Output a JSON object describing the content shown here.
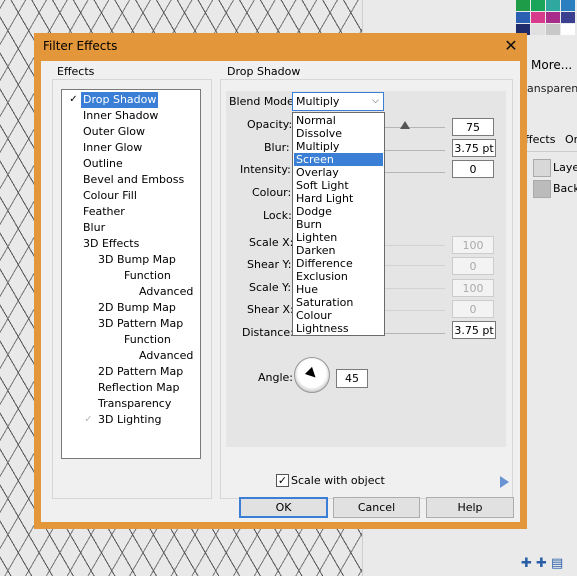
{
  "dialog": {
    "title": "Filter Effects",
    "accent_color": "#e4963a",
    "effects_group_title": "Effects",
    "right_group_title": "Drop Shadow"
  },
  "effects_tree": [
    {
      "label": "Drop Shadow",
      "level": 0,
      "checked": true,
      "selected": true,
      "has_checkbox": true
    },
    {
      "label": "Inner Shadow",
      "level": 0,
      "checked": false,
      "has_checkbox": true
    },
    {
      "label": "Outer Glow",
      "level": 0,
      "checked": false,
      "has_checkbox": true
    },
    {
      "label": "Inner Glow",
      "level": 0,
      "checked": false,
      "has_checkbox": true
    },
    {
      "label": "Outline",
      "level": 0,
      "checked": false,
      "has_checkbox": true
    },
    {
      "label": "Bevel and Emboss",
      "level": 0,
      "checked": false,
      "has_checkbox": true
    },
    {
      "label": "Colour Fill",
      "level": 0,
      "checked": false,
      "has_checkbox": true
    },
    {
      "label": "Feather",
      "level": 0,
      "checked": false,
      "has_checkbox": true
    },
    {
      "label": "Blur",
      "level": 0,
      "checked": false,
      "has_checkbox": true
    },
    {
      "label": "3D Effects",
      "level": 0,
      "checked": false,
      "has_checkbox": true
    },
    {
      "label": "3D Bump Map",
      "level": 1,
      "checked": false,
      "has_checkbox": true
    },
    {
      "label": "Function",
      "level": 2,
      "has_checkbox": false
    },
    {
      "label": "Advanced",
      "level": 3,
      "has_checkbox": false
    },
    {
      "label": "2D Bump Map",
      "level": 1,
      "checked": false,
      "has_checkbox": true
    },
    {
      "label": "3D Pattern Map",
      "level": 1,
      "checked": false,
      "has_checkbox": true
    },
    {
      "label": "Function",
      "level": 2,
      "has_checkbox": false
    },
    {
      "label": "Advanced",
      "level": 3,
      "has_checkbox": false
    },
    {
      "label": "2D Pattern Map",
      "level": 1,
      "checked": false,
      "has_checkbox": true
    },
    {
      "label": "Reflection Map",
      "level": 1,
      "checked": false,
      "has_checkbox": true
    },
    {
      "label": "Transparency",
      "level": 1,
      "checked": false,
      "has_checkbox": true
    },
    {
      "label": "3D Lighting",
      "level": 1,
      "checked": true,
      "dim_check": true,
      "has_checkbox": true
    }
  ],
  "props": {
    "blend_mode_label": "Blend Mode:",
    "blend_mode_value": "Multiply",
    "opacity_label": "Opacity:",
    "opacity_value": "75",
    "blur_label": "Blur:",
    "blur_value": "3.75 pt",
    "intensity_label": "Intensity:",
    "intensity_value": "0",
    "colour_label": "Colour:",
    "lock_label": "Lock:",
    "scale_x_label": "Scale X:",
    "scale_x_value": "100",
    "shear_y_label": "Shear Y:",
    "shear_y_value": "0",
    "scale_y_label": "Scale Y:",
    "scale_y_value": "100",
    "shear_x_label": "Shear X:",
    "shear_x_value": "0",
    "distance_label": "Distance:",
    "distance_value": "3.75 pt",
    "angle_label": "Angle:",
    "angle_value": "45"
  },
  "blend_modes": [
    "Normal",
    "Dissolve",
    "Multiply",
    "Screen",
    "Overlay",
    "Soft Light",
    "Hard Light",
    "Dodge",
    "Burn",
    "Lighten",
    "Darken",
    "Difference",
    "Exclusion",
    "Hue",
    "Saturation",
    "Colour",
    "Lightness"
  ],
  "blend_mode_highlighted": "Screen",
  "scale_with_object": {
    "label": "Scale with object",
    "checked": true
  },
  "buttons": {
    "ok": "OK",
    "cancel": "Cancel",
    "help": "Help"
  },
  "background_app": {
    "more_label": "More...",
    "transparency_label": "ansparency",
    "tab_effects": "ffects",
    "tab_other": "On",
    "layer1": "Laye",
    "layer2": "Backg",
    "swatch_colors": [
      "#1f9c48",
      "#1aa55a",
      "#2fa9a0",
      "#2a7fc0",
      "#2b5fb2",
      "#d83a8c",
      "#a82c8a",
      "#3a3f8f",
      "#1f2b6a",
      "#e0e0e0",
      "#c8c8c8",
      "#ffffff"
    ]
  }
}
